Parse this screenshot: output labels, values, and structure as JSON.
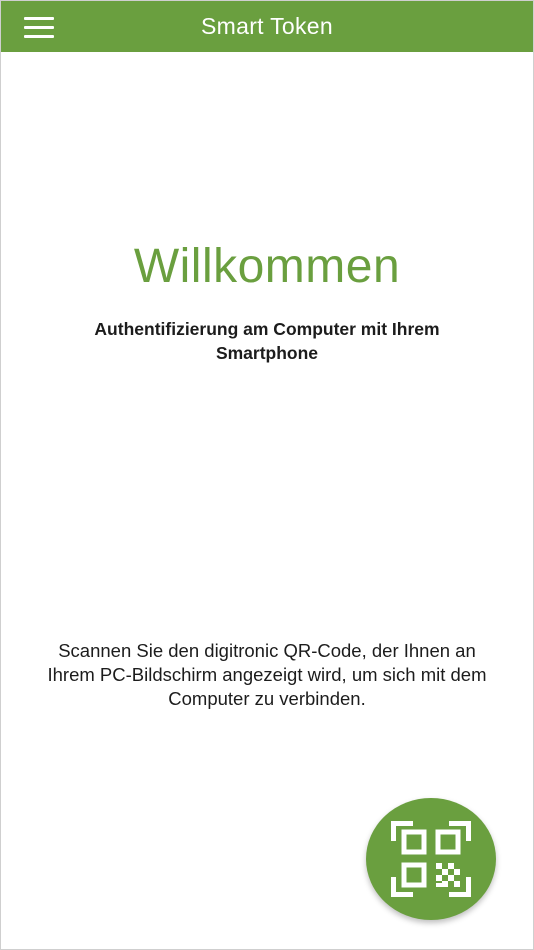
{
  "appbar": {
    "title": "Smart Token",
    "menu_icon": "hamburger-menu-icon"
  },
  "main": {
    "heading": "Willkommen",
    "subtitle": "Authentifizierung am Computer mit Ihrem Smartphone",
    "instruction": "Scannen Sie den digitronic QR-Code, der Ihnen an Ihrem PC-Bildschirm angezeigt wird, um sich mit dem Computer zu verbinden."
  },
  "fab": {
    "icon": "qr-scan-icon"
  },
  "colors": {
    "primary": "#6a9f3f",
    "text": "#1c1c1c",
    "background": "#ffffff"
  }
}
